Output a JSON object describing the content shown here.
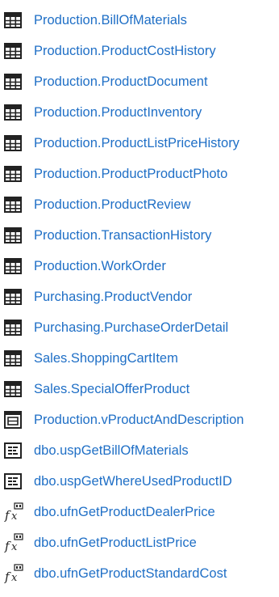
{
  "link_color": "#1f6fc6",
  "icon_color": "#222222",
  "objects": [
    {
      "type": "table",
      "icon": "table-icon",
      "label": "Production.BillOfMaterials"
    },
    {
      "type": "table",
      "icon": "table-icon",
      "label": "Production.ProductCostHistory"
    },
    {
      "type": "table",
      "icon": "table-icon",
      "label": "Production.ProductDocument"
    },
    {
      "type": "table",
      "icon": "table-icon",
      "label": "Production.ProductInventory"
    },
    {
      "type": "table",
      "icon": "table-icon",
      "label": "Production.ProductListPriceHistory"
    },
    {
      "type": "table",
      "icon": "table-icon",
      "label": "Production.ProductProductPhoto"
    },
    {
      "type": "table",
      "icon": "table-icon",
      "label": "Production.ProductReview"
    },
    {
      "type": "table",
      "icon": "table-icon",
      "label": "Production.TransactionHistory"
    },
    {
      "type": "table",
      "icon": "table-icon",
      "label": "Production.WorkOrder"
    },
    {
      "type": "table",
      "icon": "table-icon",
      "label": "Purchasing.ProductVendor"
    },
    {
      "type": "table",
      "icon": "table-icon",
      "label": "Purchasing.PurchaseOrderDetail"
    },
    {
      "type": "table",
      "icon": "table-icon",
      "label": "Sales.ShoppingCartItem"
    },
    {
      "type": "table",
      "icon": "table-icon",
      "label": "Sales.SpecialOfferProduct"
    },
    {
      "type": "view",
      "icon": "view-icon",
      "label": "Production.vProductAndDescription"
    },
    {
      "type": "procedure",
      "icon": "stored-procedure-icon",
      "label": "dbo.uspGetBillOfMaterials"
    },
    {
      "type": "procedure",
      "icon": "stored-procedure-icon",
      "label": "dbo.uspGetWhereUsedProductID"
    },
    {
      "type": "function",
      "icon": "function-icon",
      "label": "dbo.ufnGetProductDealerPrice"
    },
    {
      "type": "function",
      "icon": "function-icon",
      "label": "dbo.ufnGetProductListPrice"
    },
    {
      "type": "function",
      "icon": "function-icon",
      "label": "dbo.ufnGetProductStandardCost"
    }
  ]
}
